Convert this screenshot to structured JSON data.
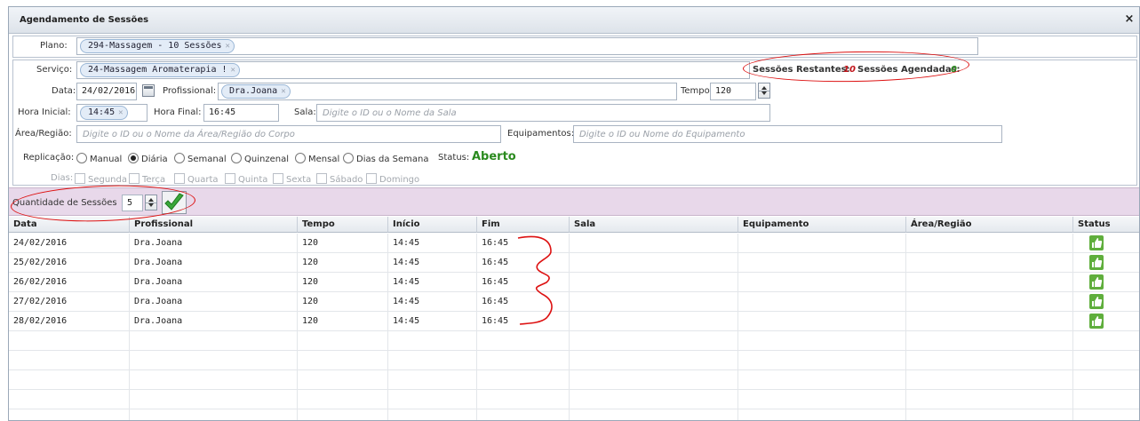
{
  "window": {
    "title": "Agendamento de Sessões",
    "close_glyph": "×"
  },
  "form": {
    "plano_label": "Plano:",
    "plano_tag": "294-Massagem - 10 Sessões",
    "servico_label": "Serviço:",
    "servico_tag": "24-Massagem Aromaterapia !",
    "sessoes_restantes_label": "Sessões Restantes:",
    "sessoes_restantes_value": "10",
    "sessoes_agendadas_label": "Sessões Agendadas:",
    "sessoes_agendadas_value": "0",
    "data_label": "Data:",
    "data_value": "24/02/2016",
    "profissional_label": "Profissional:",
    "profissional_tag": "Dra.Joana",
    "tempo_label": "Tempo:",
    "tempo_value": "120",
    "hora_inicial_label": "Hora Inicial:",
    "hora_inicial_tag": "14:45",
    "hora_final_label": "Hora Final:",
    "hora_final_value": "16:45",
    "sala_label": "Sala:",
    "sala_placeholder": "Digite o ID ou o Nome da Sala",
    "area_label": "Área/Região:",
    "area_placeholder": "Digite o ID ou o Nome da Área/Região do Corpo",
    "equipamentos_label": "Equipamentos:",
    "equipamentos_placeholder": "Digite o ID ou Nome do Equipamento",
    "replicacao_label": "Replicação:",
    "replicacao_options": [
      "Manual",
      "Diária",
      "Semanal",
      "Quinzenal",
      "Mensal",
      "Dias da Semana"
    ],
    "replicacao_selected": "Diária",
    "status_label": "Status:",
    "status_value": "Aberto",
    "status_color": "#2a8a1e",
    "dias_label": "Dias:",
    "dias_options": [
      "Segunda",
      "Terça",
      "Quarta",
      "Quinta",
      "Sexta",
      "Sábado",
      "Domingo"
    ]
  },
  "quantidade": {
    "label": "Quantidade de Sessões",
    "value": "5",
    "confirm_icon": "checkmark-icon"
  },
  "table": {
    "columns": [
      "Data",
      "Profissional",
      "Tempo",
      "Início",
      "Fim",
      "Sala",
      "Equipamento",
      "Área/Região",
      "Status"
    ],
    "rows": [
      {
        "data": "24/02/2016",
        "profissional": "Dra.Joana",
        "tempo": "120",
        "inicio": "14:45",
        "fim": "16:45",
        "sala": "",
        "equipamento": "",
        "area": "",
        "status_icon": "thumbs-up-icon"
      },
      {
        "data": "25/02/2016",
        "profissional": "Dra.Joana",
        "tempo": "120",
        "inicio": "14:45",
        "fim": "16:45",
        "sala": "",
        "equipamento": "",
        "area": "",
        "status_icon": "thumbs-up-icon"
      },
      {
        "data": "26/02/2016",
        "profissional": "Dra.Joana",
        "tempo": "120",
        "inicio": "14:45",
        "fim": "16:45",
        "sala": "",
        "equipamento": "",
        "area": "",
        "status_icon": "thumbs-up-icon"
      },
      {
        "data": "27/02/2016",
        "profissional": "Dra.Joana",
        "tempo": "120",
        "inicio": "14:45",
        "fim": "16:45",
        "sala": "",
        "equipamento": "",
        "area": "",
        "status_icon": "thumbs-up-icon"
      },
      {
        "data": "28/02/2016",
        "profissional": "Dra.Joana",
        "tempo": "120",
        "inicio": "14:45",
        "fim": "16:45",
        "sala": "",
        "equipamento": "",
        "area": "",
        "status_icon": "thumbs-up-icon"
      }
    ]
  },
  "colors": {
    "annotation": "#dd1111",
    "accent_green": "#2a8a1e",
    "qty_bar": "#e8d8ea"
  }
}
